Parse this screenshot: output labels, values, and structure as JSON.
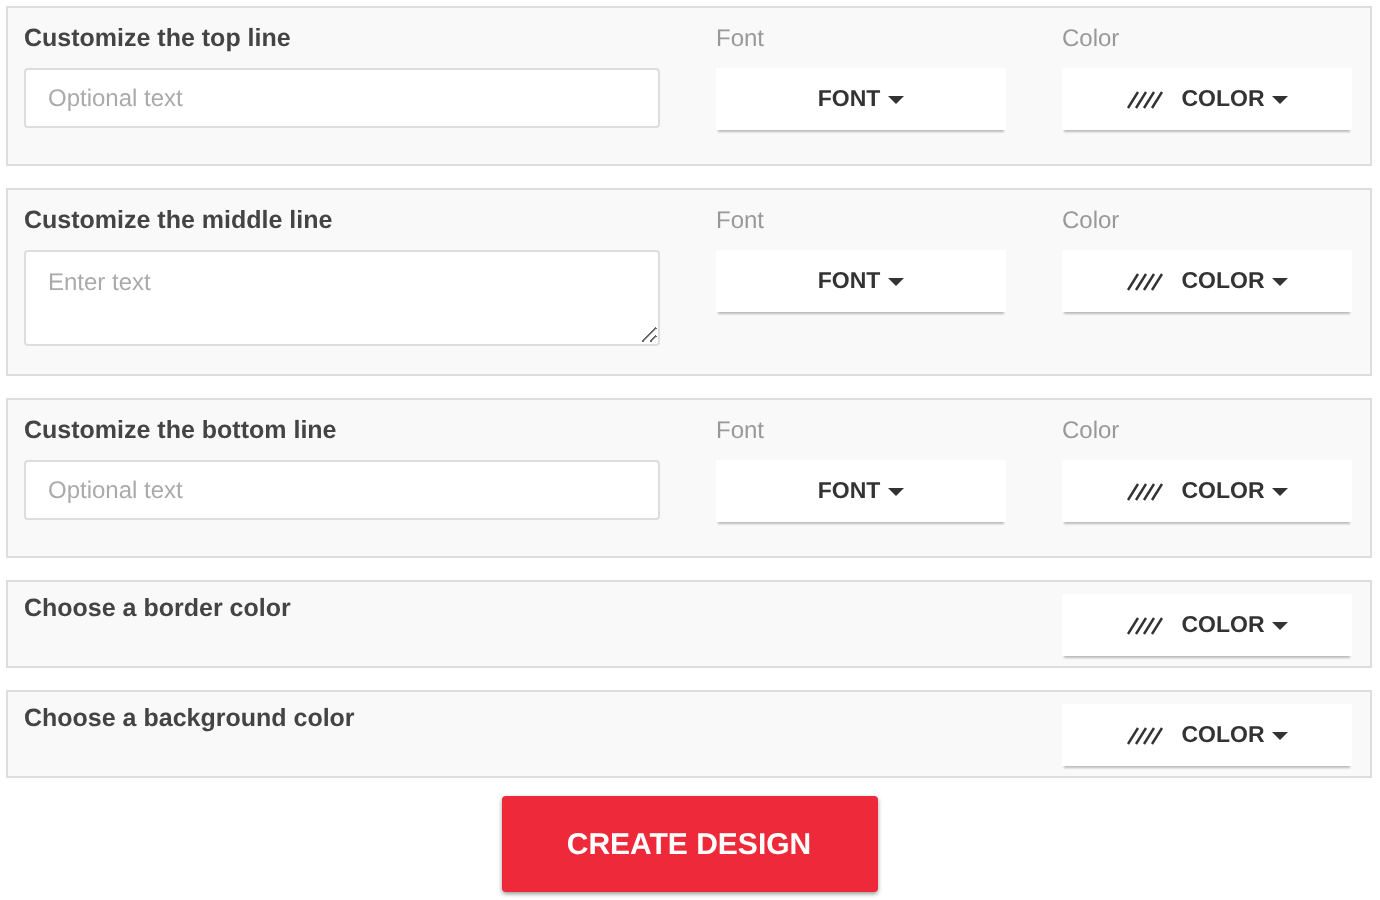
{
  "sections": [
    {
      "kind": "line",
      "title": "Customize the top line",
      "field": {
        "kind": "input",
        "placeholder": "Optional text"
      },
      "font_label": "Font",
      "font_button": "FONT",
      "color_label": "Color",
      "color_button": "COLOR"
    },
    {
      "kind": "line",
      "title": "Customize the middle line",
      "field": {
        "kind": "textarea",
        "placeholder": "Enter text"
      },
      "font_label": "Font",
      "font_button": "FONT",
      "color_label": "Color",
      "color_button": "COLOR"
    },
    {
      "kind": "line",
      "title": "Customize the bottom line",
      "field": {
        "kind": "input",
        "placeholder": "Optional text"
      },
      "font_label": "Font",
      "font_button": "FONT",
      "color_label": "Color",
      "color_button": "COLOR"
    },
    {
      "kind": "color",
      "title": "Choose a border color",
      "color_button": "COLOR"
    },
    {
      "kind": "color",
      "title": "Choose a background color",
      "color_button": "COLOR"
    }
  ],
  "submit": "CREATE DESIGN"
}
